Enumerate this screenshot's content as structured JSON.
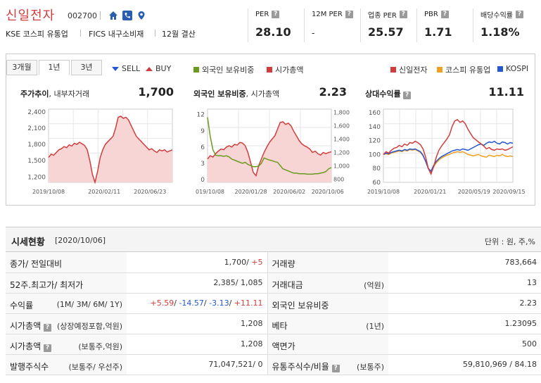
{
  "header": {
    "company": "신일전자",
    "code": "002700",
    "meta": [
      "KSE  코스피 유통업",
      "FICS 내구소비재",
      "12월 결산"
    ],
    "metrics": [
      {
        "label": "PER",
        "value": "28.10"
      },
      {
        "label": "12M PER",
        "value": "-"
      },
      {
        "label": "업종 PER",
        "value": "25.57"
      },
      {
        "label": "PBR",
        "value": "1.71"
      },
      {
        "label": "배당수익률",
        "value": "1.18%"
      }
    ]
  },
  "tabs": [
    "3개월",
    "1년",
    "3년"
  ],
  "active_tab": "1년",
  "legend_top": {
    "sell": "SELL",
    "buy": "BUY",
    "foreign": "외국인 보유비중",
    "mcap": "시가총액",
    "rel_a": "신일전자",
    "rel_b": "코스피 유통업",
    "rel_c": "KOSPI"
  },
  "charts": {
    "price": {
      "title": "주가추이",
      "sub": ", 내부자거래",
      "value": "1,700"
    },
    "foreign": {
      "title": "외국인 보유비중",
      "sub": ", 시가총액",
      "value": "2.23"
    },
    "relative": {
      "title": "상대수익률",
      "value": "11.11"
    }
  },
  "chart_data": [
    {
      "type": "area",
      "title": "주가추이",
      "x_ticks": [
        "2019/10/08",
        "2020/02/11",
        "2020/06/23"
      ],
      "y_ticks": [
        "2,400",
        "2,100",
        "1,800",
        "1,500",
        "1,200"
      ],
      "ylim": [
        1100,
        2450
      ],
      "series": [
        {
          "values": [
            1560,
            1620,
            1600,
            1650,
            1700,
            1720,
            1760,
            1740,
            1790,
            1770,
            1820,
            1800,
            1840,
            1810,
            1780,
            1700,
            1500,
            1250,
            1100,
            1300,
            1550,
            1700,
            1800,
            1850,
            1900,
            1950,
            2100,
            2300,
            2320,
            2280,
            2300,
            2250,
            2150,
            2050,
            1950,
            1900,
            1850,
            1800,
            1750,
            1700,
            1720,
            1680,
            1650,
            1700,
            1680,
            1700,
            1660,
            1680,
            1700
          ]
        }
      ]
    },
    {
      "type": "line",
      "title": "외국인 보유비중, 시가총액",
      "x_ticks": [
        "019/10/08",
        "2020/01/28",
        "2020/06/02",
        "2020/10/06"
      ],
      "y_left_ticks": [
        "12",
        "9",
        "6",
        "3",
        "0"
      ],
      "y_right_ticks": [
        "1,800",
        "1,600",
        "1,400",
        "1,200",
        "1,000",
        "800"
      ],
      "series": [
        {
          "name": "외국인 보유비중",
          "values": [
            11.5,
            8,
            5.5,
            4.5,
            4.4,
            4.4,
            4.3,
            4.4,
            4.2,
            3.8,
            3.6,
            3.4,
            3.2,
            3.0,
            3.2,
            2.8,
            2.6,
            2.4,
            2.4,
            2.5,
            3.0,
            4.0,
            3.8,
            3.6,
            3.5,
            3.3,
            3.2,
            2.6,
            2.0,
            1.8,
            1.6,
            1.4,
            1.2,
            1.2,
            1.1,
            1.1,
            1.1,
            1.0,
            1.0,
            1.0,
            1.1,
            1.1,
            1.2,
            1.3,
            1.5,
            2.0,
            2.23
          ]
        },
        {
          "name": "시가총액",
          "values": [
            1100,
            1150,
            1130,
            1180,
            1220,
            1250,
            1240,
            1280,
            1300,
            1280,
            1320,
            1310,
            1350,
            1340,
            1300,
            1200,
            1050,
            900,
            850,
            1000,
            1100,
            1200,
            1280,
            1350,
            1400,
            1450,
            1550,
            1650,
            1660,
            1620,
            1640,
            1600,
            1520,
            1450,
            1380,
            1330,
            1300,
            1280,
            1250,
            1200,
            1220,
            1180,
            1160,
            1200,
            1180,
            1200,
            1208
          ]
        }
      ]
    },
    {
      "type": "line",
      "title": "상대수익률",
      "x_ticks": [
        "2019/10/08",
        "2020/01/21",
        "2020/05/19",
        "2020/09/15"
      ],
      "y_ticks": [
        "160",
        "140",
        "120",
        "100",
        "80",
        "60"
      ],
      "ylim": [
        60,
        165
      ],
      "series": [
        {
          "name": "신일전자",
          "values": [
            100,
            104,
            102,
            106,
            109,
            110,
            113,
            111,
            115,
            113,
            117,
            116,
            119,
            117,
            114,
            108,
            96,
            80,
            72,
            82,
            96,
            106,
            112,
            117,
            122,
            128,
            140,
            148,
            150,
            146,
            148,
            144,
            136,
            130,
            124,
            121,
            118,
            115,
            112,
            108,
            110,
            107,
            106,
            108,
            107,
            108,
            106,
            107,
            109,
            111
          ]
        },
        {
          "name": "코스피 유통업",
          "values": [
            100,
            101,
            100,
            102,
            103,
            104,
            105,
            104,
            106,
            105,
            107,
            106,
            107,
            105,
            103,
            98,
            90,
            80,
            75,
            82,
            88,
            92,
            95,
            97,
            99,
            100,
            102,
            103,
            104,
            103,
            104,
            102,
            100,
            99,
            98,
            99,
            100,
            98,
            97,
            96,
            99,
            98,
            97,
            99,
            98,
            100,
            98,
            97,
            98,
            97
          ]
        },
        {
          "name": "KOSPI",
          "values": [
            100,
            102,
            101,
            103,
            104,
            105,
            106,
            105,
            107,
            106,
            108,
            107,
            108,
            106,
            104,
            99,
            90,
            80,
            76,
            84,
            90,
            94,
            97,
            99,
            101,
            103,
            105,
            106,
            107,
            106,
            108,
            107,
            106,
            108,
            110,
            112,
            114,
            115,
            113,
            116,
            118,
            117,
            119,
            116,
            115,
            118,
            117,
            115,
            117,
            116
          ]
        }
      ]
    }
  ],
  "table": {
    "title": "시세현황",
    "date": "[2020/10/06]",
    "unit": "단위 : 원, 주,%",
    "rows": [
      {
        "k": "종가/ 전일대비",
        "ks": "",
        "v": "1,700/ +5",
        "k2": "거래량",
        "k2s": "",
        "v2": "783,664"
      },
      {
        "k": "52주.최고가/ 최저가",
        "ks": "",
        "v": "2,385/ 1,085",
        "k2": "거래대금",
        "k2s": "(억원)",
        "v2": "13"
      },
      {
        "k": "수익률",
        "ks": "(1M/ 3M/ 6M/ 1Y)",
        "v": "",
        "k2": "외국인 보유비중",
        "k2s": "",
        "v2": "2.23"
      },
      {
        "k": "시가총액",
        "ks": "(상장예정포함,억원)",
        "v": "1,208",
        "k2": "베타",
        "k2s": "(1년)",
        "v2": "1.23095"
      },
      {
        "k": "시가총액",
        "ks": "(보통주,억원)",
        "v": "1,208",
        "k2": "액면가",
        "k2s": "",
        "v2": "500"
      },
      {
        "k": "발행주식수",
        "ks": "(보통주/ 우선주)",
        "v": "71,047,521/ 0",
        "k2": "유통주식수/비율",
        "k2s": "(보통주)",
        "v2": "59,810,969 / 84.18"
      }
    ],
    "returns": [
      "+5.59",
      "-14.57",
      "-3.13",
      "+11.11"
    ]
  },
  "colors": {
    "red": "#d23c3c",
    "green": "#6a9a1f",
    "orange": "#f0a020",
    "blue": "#2458d3",
    "area": "#f8d5d5"
  }
}
